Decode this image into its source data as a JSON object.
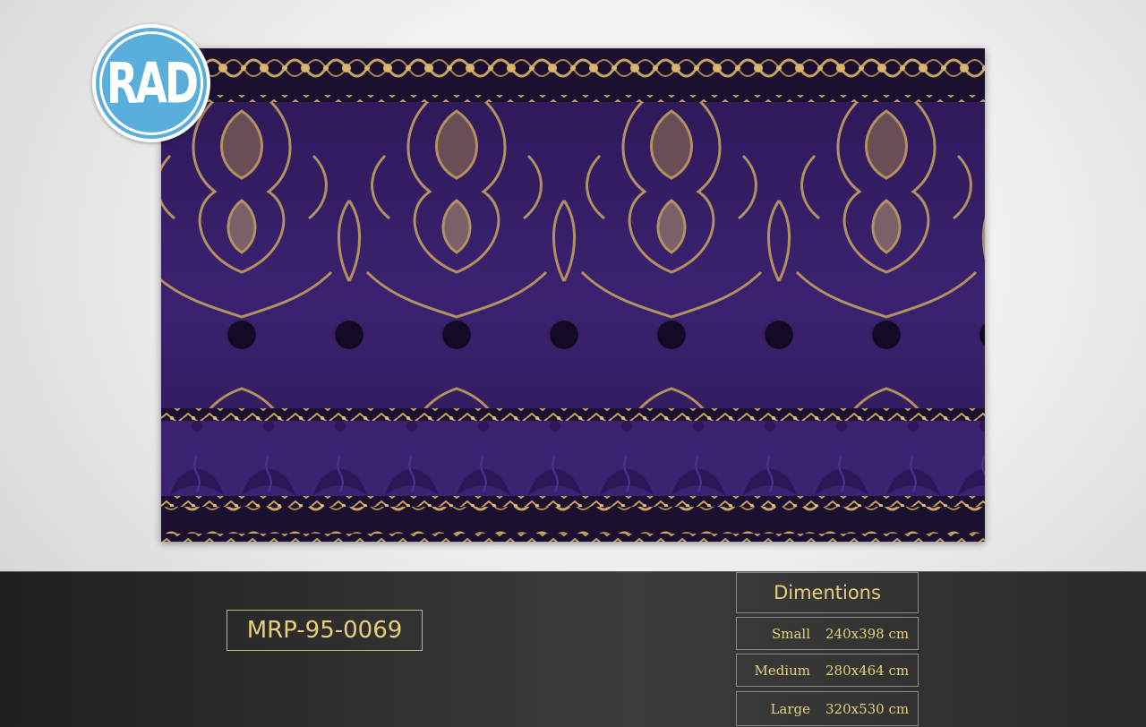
{
  "logo": {
    "text": "RAD"
  },
  "product": {
    "code": "MRP-95-0069"
  },
  "dimensions": {
    "title": "Dimentions",
    "sizes": [
      {
        "label": "Small",
        "value": "240x398 cm"
      },
      {
        "label": "Medium",
        "value": "280x464 cm"
      },
      {
        "label": "Large",
        "value": "320x530 cm"
      }
    ]
  },
  "colors": {
    "rug_purple": "#3b2270",
    "rug_dark": "#160c2c",
    "rug_gold": "#c9a45c",
    "text_gold": "#e8cf7a",
    "logo_blue": "#5aaedc"
  }
}
